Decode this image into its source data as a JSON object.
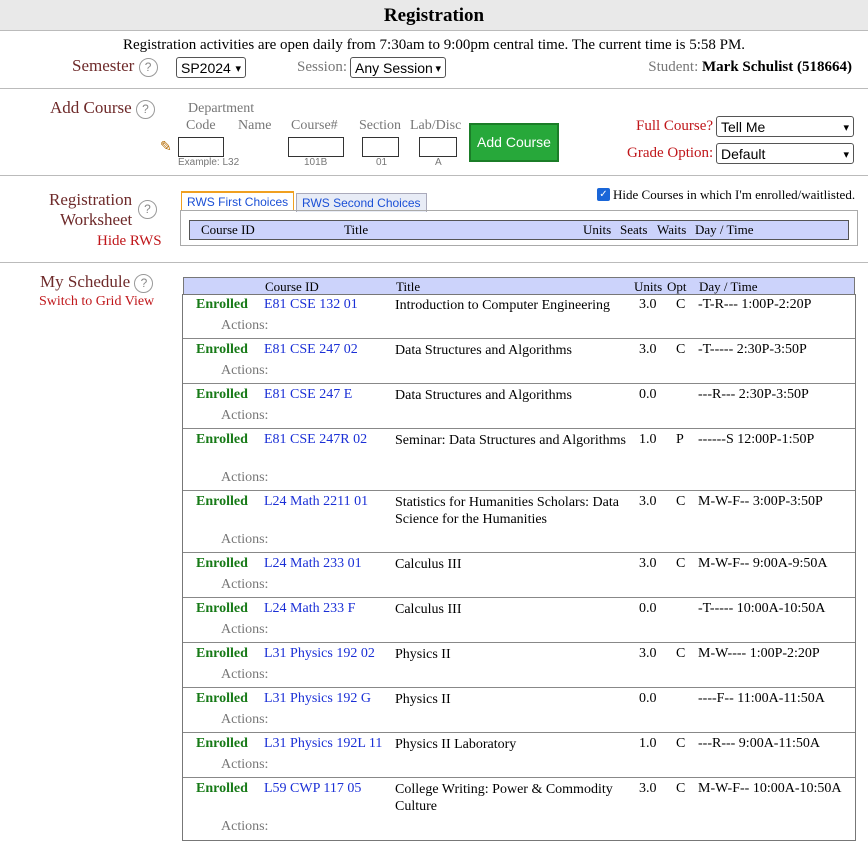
{
  "header": {
    "title": "Registration"
  },
  "notice": "Registration activities are open daily from 7:30am to 9:00pm central time. The current time is 5:58 PM.",
  "semester": {
    "label": "Semester",
    "value": "SP2024"
  },
  "session": {
    "label": "Session:",
    "value": "Any Session"
  },
  "student": {
    "label": "Student:",
    "name": "Mark  Schulist (518664)"
  },
  "add_course": {
    "label": "Add Course",
    "dept_label": "Department",
    "code_label": "Code",
    "name_label": "Name",
    "course_label": "Course#",
    "section_label": "Section",
    "lab_label": "Lab/Disc",
    "code_example": "Example: L32",
    "course_example": "101B",
    "section_example": "01",
    "lab_example": "A",
    "button": "Add Course",
    "full_course_label": "Full Course?",
    "full_course_value": "Tell Me",
    "grade_option_label": "Grade Option:",
    "grade_option_value": "Default"
  },
  "rws": {
    "label_line1": "Registration",
    "label_line2": "Worksheet",
    "hide_link": "Hide RWS",
    "tab1": "RWS First Choices",
    "tab2": "RWS Second Choices",
    "hide_checkbox_label": "Hide Courses in which I'm enrolled/waitlisted.",
    "columns": {
      "course_id": "Course ID",
      "title": "Title",
      "units": "Units",
      "seats": "Seats",
      "waits": "Waits",
      "day_time": "Day / Time"
    }
  },
  "schedule": {
    "label": "My Schedule",
    "grid_link": "Switch to Grid View",
    "columns": {
      "course_id": "Course ID",
      "title": "Title",
      "units": "Units",
      "opt": "Opt",
      "day_time": "Day / Time"
    },
    "actions_label": "Actions:",
    "rows": [
      {
        "status": "Enrolled",
        "course_id": "E81 CSE 132 01",
        "title": "Introduction to Computer Engineering",
        "units": "3.0",
        "opt": "C",
        "day_time": "-T-R--- 1:00P-2:20P"
      },
      {
        "status": "Enrolled",
        "course_id": "E81 CSE 247 02",
        "title": "Data Structures and Algorithms",
        "units": "3.0",
        "opt": "C",
        "day_time": "-T----- 2:30P-3:50P"
      },
      {
        "status": "Enrolled",
        "course_id": "E81 CSE 247 E",
        "title": "Data Structures and Algorithms",
        "units": "0.0",
        "opt": "",
        "day_time": "---R--- 2:30P-3:50P"
      },
      {
        "status": "Enrolled",
        "course_id": "E81 CSE 247R 02",
        "title": "Seminar: Data Structures and Algorithms",
        "units": "1.0",
        "opt": "P",
        "day_time": "------S 12:00P-1:50P"
      },
      {
        "status": "Enrolled",
        "course_id": "L24 Math 2211 01",
        "title": "Statistics for Humanities Scholars: Data Science for the Humanities",
        "units": "3.0",
        "opt": "C",
        "day_time": "M-W-F-- 3:00P-3:50P"
      },
      {
        "status": "Enrolled",
        "course_id": "L24 Math 233 01",
        "title": "Calculus III",
        "units": "3.0",
        "opt": "C",
        "day_time": "M-W-F-- 9:00A-9:50A"
      },
      {
        "status": "Enrolled",
        "course_id": "L24 Math 233 F",
        "title": "Calculus III",
        "units": "0.0",
        "opt": "",
        "day_time": "-T----- 10:00A-10:50A"
      },
      {
        "status": "Enrolled",
        "course_id": "L31 Physics 192 02",
        "title": "Physics II",
        "units": "3.0",
        "opt": "C",
        "day_time": "M-W---- 1:00P-2:20P"
      },
      {
        "status": "Enrolled",
        "course_id": "L31 Physics 192 G",
        "title": "Physics II",
        "units": "0.0",
        "opt": "",
        "day_time": "----F-- 11:00A-11:50A"
      },
      {
        "status": "Enrolled",
        "course_id": "L31 Physics 192L 11",
        "title": "Physics II Laboratory",
        "units": "1.0",
        "opt": "C",
        "day_time": "---R--- 9:00A-11:50A"
      },
      {
        "status": "Enrolled",
        "course_id": "L59 CWP 117 05",
        "title": "College Writing: Power & Commodity Culture",
        "units": "3.0",
        "opt": "C",
        "day_time": "M-W-F-- 10:00A-10:50A"
      }
    ]
  }
}
